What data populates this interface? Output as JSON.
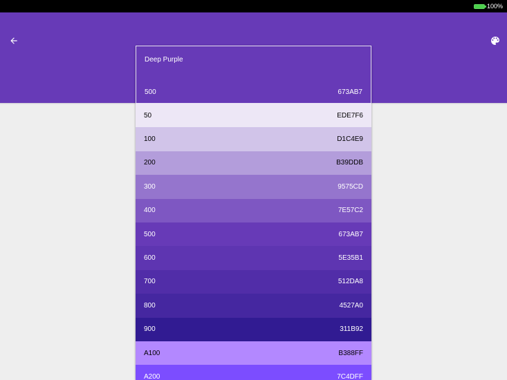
{
  "status_bar": {
    "battery": "100%",
    "battery_icon": "battery-full-icon"
  },
  "app_bar": {
    "color": "#673AB7",
    "back_icon": "arrow-back-icon",
    "palette_icon": "palette-icon"
  },
  "header": {
    "title": "Deep Purple",
    "primary_shade": {
      "name": "500",
      "hex": "673AB7",
      "color": "#673AB7"
    }
  },
  "shades": [
    {
      "name": "50",
      "hex": "EDE7F6",
      "color": "#EDE7F6",
      "text_color": "#000000"
    },
    {
      "name": "100",
      "hex": "D1C4E9",
      "color": "#D1C4E9",
      "text_color": "#000000"
    },
    {
      "name": "200",
      "hex": "B39DDB",
      "color": "#B39DDB",
      "text_color": "#000000"
    },
    {
      "name": "300",
      "hex": "9575CD",
      "color": "#9575CD",
      "text_color": "#FFFFFF"
    },
    {
      "name": "400",
      "hex": "7E57C2",
      "color": "#7E57C2",
      "text_color": "#FFFFFF"
    },
    {
      "name": "500",
      "hex": "673AB7",
      "color": "#673AB7",
      "text_color": "#FFFFFF"
    },
    {
      "name": "600",
      "hex": "5E35B1",
      "color": "#5E35B1",
      "text_color": "#FFFFFF"
    },
    {
      "name": "700",
      "hex": "512DA8",
      "color": "#512DA8",
      "text_color": "#FFFFFF"
    },
    {
      "name": "800",
      "hex": "4527A0",
      "color": "#4527A0",
      "text_color": "#FFFFFF"
    },
    {
      "name": "900",
      "hex": "311B92",
      "color": "#311B92",
      "text_color": "#FFFFFF"
    },
    {
      "name": "A100",
      "hex": "B388FF",
      "color": "#B388FF",
      "text_color": "#000000"
    },
    {
      "name": "A200",
      "hex": "7C4DFF",
      "color": "#7C4DFF",
      "text_color": "#FFFFFF"
    }
  ]
}
